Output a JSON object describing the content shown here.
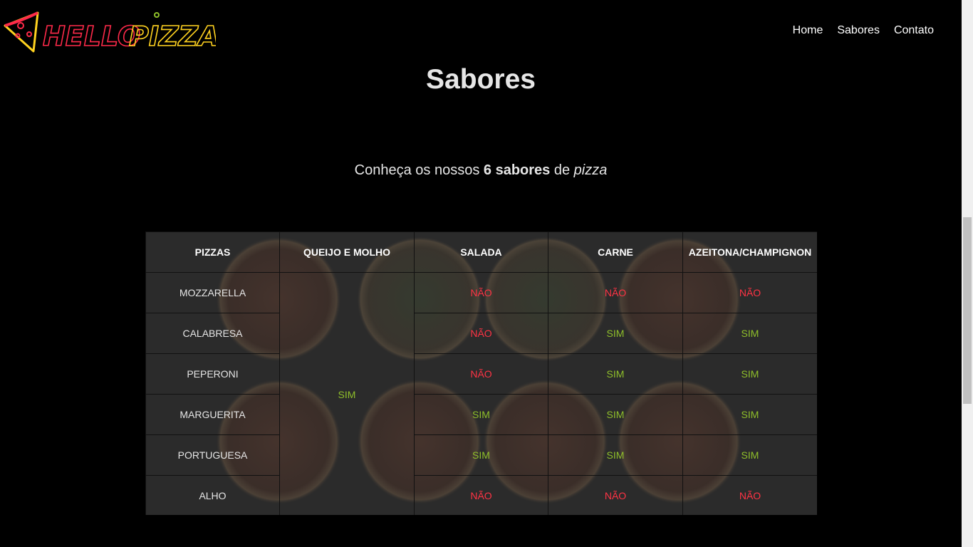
{
  "header": {
    "logo_text_1": "HELLO",
    "logo_text_2": "PIZZA",
    "nav": [
      "Home",
      "Sabores",
      "Contato"
    ]
  },
  "main": {
    "title": "Sabores",
    "subtitle_pre": "Conheça os nossos ",
    "subtitle_bold": "6 sabores",
    "subtitle_mid": " de ",
    "subtitle_italic": "pizza"
  },
  "table": {
    "headers": [
      "PIZZAS",
      "QUEIJO E MOLHO",
      "SALADA",
      "CARNE",
      "AZEITONA/CHAMPIGNON"
    ],
    "queijo_e_molho": "SIM",
    "rows": [
      {
        "pizza": "MOZZARELLA",
        "salada": "NÃO",
        "carne": "NÃO",
        "azeitona": "NÃO"
      },
      {
        "pizza": "CALABRESA",
        "salada": "NÃO",
        "carne": "SIM",
        "azeitona": "SIM"
      },
      {
        "pizza": "PEPERONI",
        "salada": "NÃO",
        "carne": "SIM",
        "azeitona": "SIM"
      },
      {
        "pizza": "MARGUERITA",
        "salada": "SIM",
        "carne": "SIM",
        "azeitona": "SIM"
      },
      {
        "pizza": "PORTUGUESA",
        "salada": "SIM",
        "carne": "SIM",
        "azeitona": "SIM"
      },
      {
        "pizza": "ALHO",
        "salada": "NÃO",
        "carne": "NÃO",
        "azeitona": "NÃO"
      }
    ]
  },
  "colors": {
    "sim": "#8fbf2a",
    "nao": "#ff3344",
    "logo_red": "#ff2a4a",
    "logo_yellow": "#ffd21f"
  }
}
